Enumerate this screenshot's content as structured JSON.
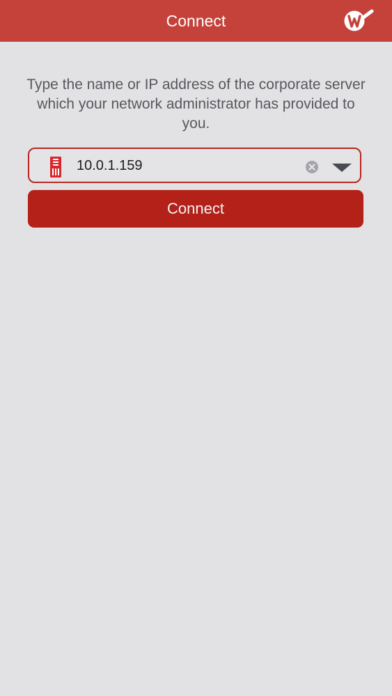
{
  "header": {
    "title": "Connect",
    "logo_icon": "watchguard-logo-icon",
    "brand_color": "#c5423b"
  },
  "instructions": {
    "text": "Type the name or IP address of the corporate server which your network administrator has provided to you."
  },
  "server_field": {
    "icon": "server-icon",
    "value": "10.0.1.159",
    "clear_icon": "clear-icon",
    "dropdown_icon": "chevron-down-icon",
    "border_color": "#b8261f"
  },
  "connect_button": {
    "label": "Connect",
    "color": "#b32118"
  }
}
